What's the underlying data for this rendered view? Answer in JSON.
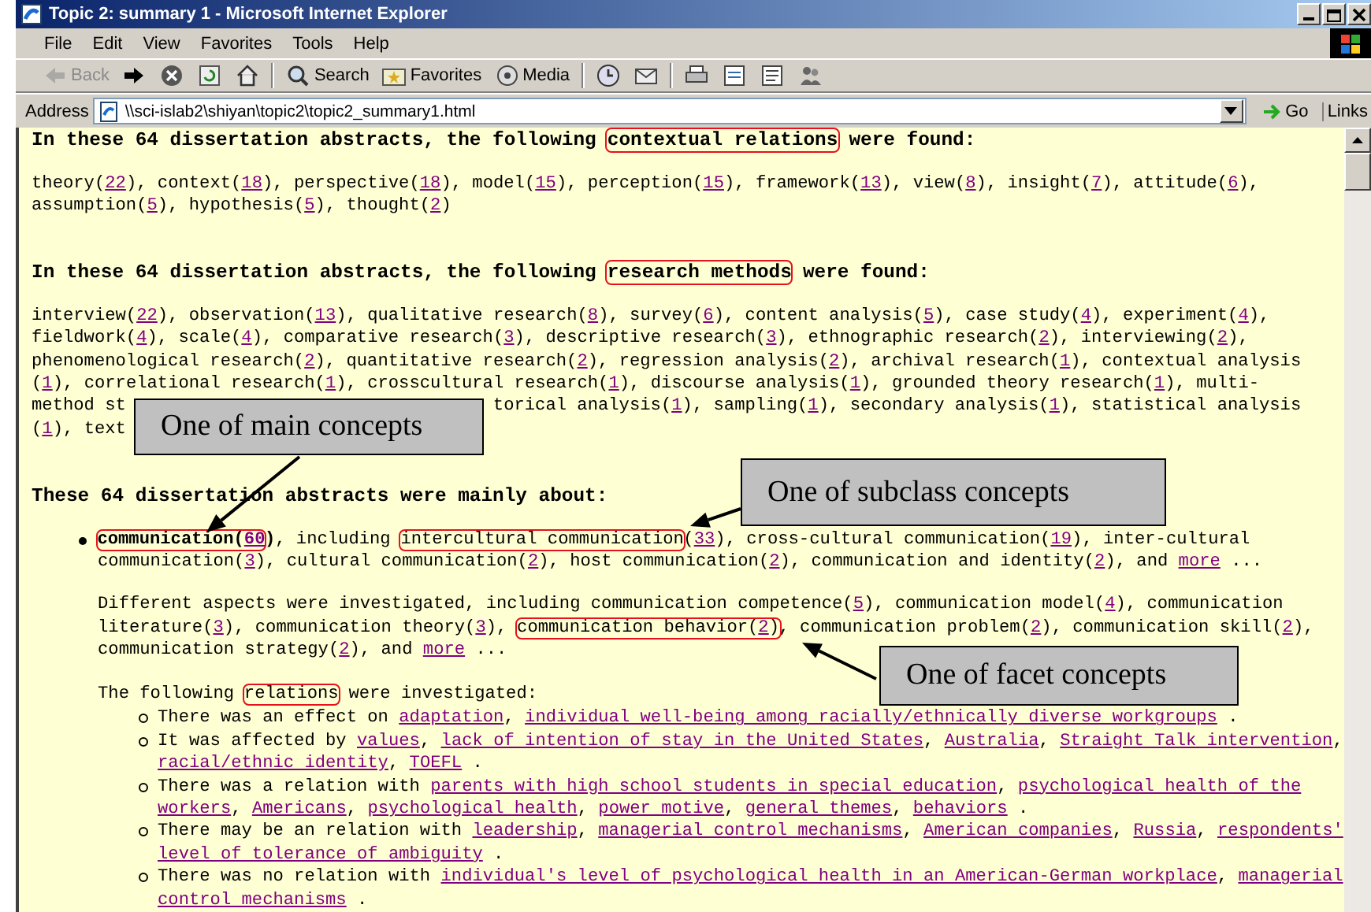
{
  "window": {
    "title": "Topic 2: summary 1 - Microsoft Internet Explorer"
  },
  "menu": [
    "File",
    "Edit",
    "View",
    "Favorites",
    "Tools",
    "Help"
  ],
  "toolbar": [
    {
      "kind": "back",
      "label": "Back",
      "disabled": true
    },
    {
      "kind": "forward",
      "disabled": false
    },
    {
      "kind": "stop",
      "disabled": false
    },
    {
      "kind": "refresh",
      "disabled": false
    },
    {
      "kind": "home",
      "disabled": false
    },
    {
      "kind": "search",
      "label": "Search",
      "disabled": false
    },
    {
      "kind": "favorites",
      "label": "Favorites",
      "disabled": false
    },
    {
      "kind": "media",
      "label": "Media",
      "disabled": false
    },
    {
      "kind": "history",
      "disabled": false
    },
    {
      "kind": "mail",
      "disabled": false
    },
    {
      "kind": "print",
      "disabled": false
    },
    {
      "kind": "edit",
      "disabled": false
    },
    {
      "kind": "discuss",
      "disabled": false
    },
    {
      "kind": "messenger",
      "disabled": false
    }
  ],
  "address": {
    "label": "Address",
    "value": "\\\\sci-islab2\\shiyan\\topic2\\topic2_summary1.html",
    "go": "Go",
    "links": "Links"
  },
  "content": [
    {
      "kind": "heading",
      "lines": [
        [
          "In these 64 dissertation abstracts, the following ",
          {
            "highlight": [
              "contextual relations"
            ]
          },
          " were found:"
        ]
      ]
    },
    {
      "kind": "text",
      "lines": [
        [
          "theory(",
          {
            "link": "22"
          },
          "), context(",
          {
            "link": "18"
          },
          "), perspective(",
          {
            "link": "18"
          },
          "), model(",
          {
            "link": "15"
          },
          "), perception(",
          {
            "link": "15"
          },
          "), framework(",
          {
            "link": "13"
          },
          "), view(",
          {
            "link": "8"
          },
          "), insight(",
          {
            "link": "7"
          },
          "), attitude(",
          {
            "link": "6"
          },
          "),"
        ],
        [
          "assumption(",
          {
            "link": "5"
          },
          "), hypothesis(",
          {
            "link": "5"
          },
          "), thought(",
          {
            "link": "2"
          },
          ")"
        ]
      ]
    },
    {
      "kind": "heading",
      "lines": [
        [
          "In these 64 dissertation abstracts, the following ",
          {
            "highlight": [
              "research methods"
            ]
          },
          " were found:"
        ]
      ]
    },
    {
      "kind": "text",
      "lines": [
        [
          "interview(",
          {
            "link": "22"
          },
          "), observation(",
          {
            "link": "13"
          },
          "), qualitative research(",
          {
            "link": "8"
          },
          "), survey(",
          {
            "link": "6"
          },
          "), content analysis(",
          {
            "link": "5"
          },
          "), case study(",
          {
            "link": "4"
          },
          "), experiment(",
          {
            "link": "4"
          },
          "),"
        ],
        [
          "fieldwork(",
          {
            "link": "4"
          },
          "), scale(",
          {
            "link": "4"
          },
          "), comparative research(",
          {
            "link": "3"
          },
          "), descriptive research(",
          {
            "link": "3"
          },
          "), ethnographic research(",
          {
            "link": "2"
          },
          "), interviewing(",
          {
            "link": "2"
          },
          "),"
        ],
        [
          "phenomenological research(",
          {
            "link": "2"
          },
          "), quantitative research(",
          {
            "link": "2"
          },
          "), regression analysis(",
          {
            "link": "2"
          },
          "), archival research(",
          {
            "link": "1"
          },
          "), contextual analysis"
        ],
        [
          "(",
          {
            "link": "1"
          },
          "), correlational research(",
          {
            "link": "1"
          },
          "), crosscultural research(",
          {
            "link": "1"
          },
          "), discourse analysis(",
          {
            "link": "1"
          },
          "), grounded theory research(",
          {
            "link": "1"
          },
          "), multi-"
        ]
      ]
    },
    {
      "kind": "fragments",
      "lines": [
        [
          [
            "method st"
          ],
          [
            "torical analysis(",
            {
              "link": "1"
            },
            "), sampling(",
            {
              "link": "1"
            },
            "), secondary analysis(",
            {
              "link": "1"
            },
            "), statistical analysis"
          ]
        ],
        [
          [
            "(",
            {
              "link": "1"
            },
            "), text"
          ]
        ]
      ]
    },
    {
      "kind": "heading",
      "lines": [
        [
          "These 64 dissertation abstracts were mainly about:"
        ]
      ]
    },
    {
      "kind": "bullet",
      "lines": [
        [
          {
            "highlight": [
              "**communication(**",
              {
                "link": "**60**"
              }
            ]
          },
          "**)**, including ",
          {
            "highlight": [
              "intercultural communication"
            ]
          },
          "(",
          {
            "link": "33"
          },
          "), cross-cultural communication(",
          {
            "link": "19"
          },
          "), inter-cultural"
        ],
        [
          "communication(",
          {
            "link": "3"
          },
          "), cultural communication(",
          {
            "link": "2"
          },
          "), host communication(",
          {
            "link": "2"
          },
          "), communication and identity(",
          {
            "link": "2"
          },
          "), and ",
          {
            "link": "more"
          },
          " ..."
        ]
      ],
      "children": [
        {
          "kind": "note",
          "lines": [
            [
              "Different aspects were investigated, including communication competence(",
              {
                "link": "5"
              },
              "), communication model(",
              {
                "link": "4"
              },
              "), communication"
            ],
            [
              "literature(",
              {
                "link": "3"
              },
              "), communication theory(",
              {
                "link": "3"
              },
              "), ",
              {
                "highlight": [
                  "communication behavior(",
                  {
                    "link": "2"
                  },
                  ")"
                ]
              },
              ", communication problem(",
              {
                "link": "2"
              },
              "), communication skill(",
              {
                "link": "2"
              },
              "),"
            ],
            [
              "communication strategy(",
              {
                "link": "2"
              },
              "), and ",
              {
                "link": "more"
              },
              " ..."
            ]
          ]
        },
        {
          "kind": "note",
          "lines": [
            [
              "The following ",
              {
                "highlight": [
                  "relations"
                ]
              },
              " were investigated:"
            ]
          ],
          "children": [
            {
              "kind": "subbullet",
              "lines": [
                [
                  "There was an effect on ",
                  {
                    "link": "adaptation"
                  },
                  ", ",
                  {
                    "link": "individual well-being among racially/ethnically diverse workgroups"
                  },
                  " ."
                ]
              ]
            },
            {
              "kind": "subbullet",
              "lines": [
                [
                  "It was affected by ",
                  {
                    "link": "values"
                  },
                  ", ",
                  {
                    "link": "lack of intention of stay in the United States"
                  },
                  ", ",
                  {
                    "link": "Australia"
                  },
                  ", ",
                  {
                    "link": "Straight Talk intervention"
                  },
                  ","
                ],
                [
                  {
                    "link": "racial/ethnic identity"
                  },
                  ", ",
                  {
                    "link": "TOEFL"
                  },
                  " ."
                ]
              ]
            },
            {
              "kind": "subbullet",
              "lines": [
                [
                  "There was a relation with ",
                  {
                    "link": "parents with high school students in special education"
                  },
                  ", ",
                  {
                    "link": "psychological health of the"
                  }
                ],
                [
                  {
                    "link": "workers"
                  },
                  ", ",
                  {
                    "link": "Americans"
                  },
                  ", ",
                  {
                    "link": "psychological health"
                  },
                  ", ",
                  {
                    "link": "power motive"
                  },
                  ", ",
                  {
                    "link": "general themes"
                  },
                  ", ",
                  {
                    "link": "behaviors"
                  },
                  " ."
                ]
              ]
            },
            {
              "kind": "subbullet",
              "lines": [
                [
                  "There may be an relation with ",
                  {
                    "link": "leadership"
                  },
                  ", ",
                  {
                    "link": "managerial control mechanisms"
                  },
                  ", ",
                  {
                    "link": "American companies"
                  },
                  ", ",
                  {
                    "link": "Russia"
                  },
                  ", ",
                  {
                    "link": "respondents'"
                  }
                ],
                [
                  {
                    "link": "level of tolerance of ambiguity"
                  },
                  " ."
                ]
              ]
            },
            {
              "kind": "subbullet",
              "lines": [
                [
                  "There was no relation with ",
                  {
                    "link": "individual's level of psychological health in an American-German workplace"
                  },
                  ", ",
                  {
                    "link": "managerial"
                  }
                ],
                [
                  {
                    "link": "control mechanisms"
                  },
                  " ."
                ]
              ]
            }
          ]
        }
      ]
    }
  ],
  "callouts": [
    {
      "text": "One of main concepts"
    },
    {
      "text": "One of subclass concepts"
    },
    {
      "text": "One of facet concepts"
    }
  ]
}
